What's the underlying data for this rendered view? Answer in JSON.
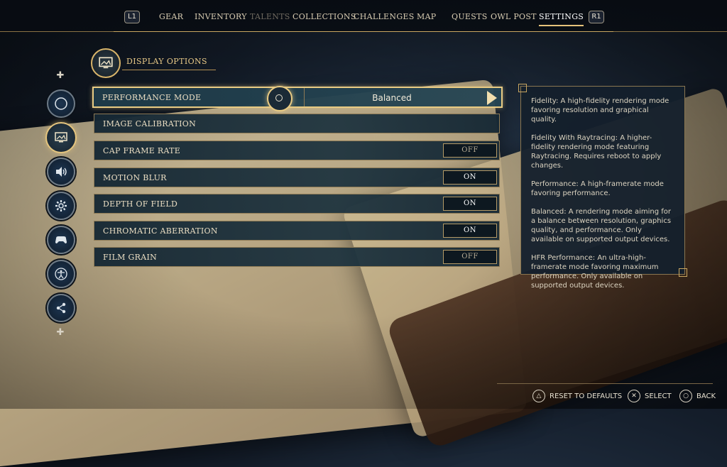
{
  "nav": {
    "left_button": "L1",
    "right_button": "R1",
    "tabs": [
      {
        "label": "GEAR",
        "state": "normal"
      },
      {
        "label": "INVENTORY",
        "state": "normal"
      },
      {
        "label": "TALENTS",
        "state": "disabled"
      },
      {
        "label": "COLLECTIONS",
        "state": "normal"
      },
      {
        "label": "CHALLENGES",
        "state": "normal"
      },
      {
        "label": "MAP",
        "state": "normal"
      },
      {
        "label": "QUESTS",
        "state": "normal"
      },
      {
        "label": "OWL POST",
        "state": "normal"
      },
      {
        "label": "SETTINGS",
        "state": "active"
      }
    ]
  },
  "rail": {
    "categories": [
      {
        "icon": "compass-icon"
      },
      {
        "icon": "display-icon",
        "active": true
      },
      {
        "icon": "speaker-icon"
      },
      {
        "icon": "gear-icon"
      },
      {
        "icon": "gamepad-icon"
      },
      {
        "icon": "accessibility-icon"
      },
      {
        "icon": "network-icon"
      }
    ]
  },
  "section": {
    "title": "DISPLAY OPTIONS",
    "icon": "display-icon"
  },
  "settings": [
    {
      "label": "PERFORMANCE MODE",
      "value": "Balanced",
      "type": "selector"
    },
    {
      "label": "IMAGE CALIBRATION",
      "type": "link"
    },
    {
      "label": "CAP FRAME RATE",
      "value": "OFF",
      "type": "toggle"
    },
    {
      "label": "MOTION BLUR",
      "value": "ON",
      "type": "toggle"
    },
    {
      "label": "DEPTH OF FIELD",
      "value": "ON",
      "type": "toggle"
    },
    {
      "label": "CHROMATIC ABERRATION",
      "value": "ON",
      "type": "toggle"
    },
    {
      "label": "FILM GRAIN",
      "value": "OFF",
      "type": "toggle"
    }
  ],
  "description": {
    "paragraphs": [
      "Fidelity: A high-fidelity rendering mode favoring resolution and graphical quality.",
      "Fidelity With Raytracing: A higher-fidelity rendering mode featuring Raytracing. Requires reboot to apply changes.",
      "Performance: A high-framerate mode favoring performance.",
      "Balanced: A rendering mode aiming for a balance between resolution, graphics quality, and performance. Only available on supported output devices.",
      "HFR Performance: An ultra-high-framerate mode favoring maximum performance. Only available on supported output devices."
    ]
  },
  "footer": {
    "reset_label": "RESET TO DEFAULTS",
    "select_label": "SELECT",
    "back_label": "BACK",
    "reset_icon": "triangle-button-icon",
    "select_icon": "cross-button-icon",
    "back_icon": "circle-button-icon"
  },
  "colors": {
    "accent_gold": "#e9cb83",
    "row_bg": "#1c3240",
    "text": "#ecdfc4"
  }
}
